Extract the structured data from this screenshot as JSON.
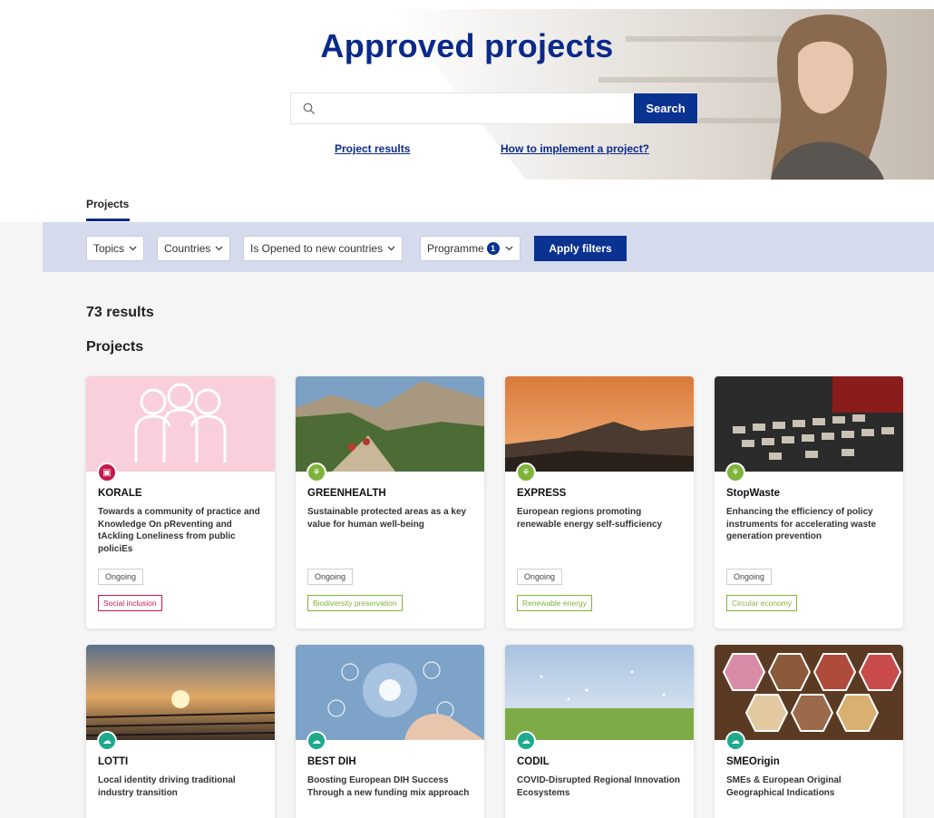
{
  "hero": {
    "title": "Approved projects",
    "search_placeholder": "",
    "search_button": "Search",
    "links": [
      "Project results",
      "How to implement a project?"
    ]
  },
  "tabs": {
    "active": "Projects"
  },
  "filters": {
    "topics": "Topics",
    "countries": "Countries",
    "opened": "Is Opened to new countries",
    "programme": "Programme",
    "programme_count": "1",
    "apply": "Apply filters"
  },
  "results": {
    "count": "73 results",
    "section": "Projects"
  },
  "colors": {
    "primary": "#0a2a8a",
    "button": "#0a3290",
    "filter_bar": "#d5daec",
    "social": "#c8174d",
    "environment": "#7fb33b",
    "innovation": "#1eaa8c"
  },
  "cards": [
    {
      "acronym": "KORALE",
      "desc": "Towards a community of practice and Knowledge On pReventing and tAckling Loneliness from public policiEs",
      "status": "Ongoing",
      "topic": "Social inclusion",
      "icon": "people-hex-icon"
    },
    {
      "acronym": "GREENHEALTH",
      "desc": "Sustainable protected areas as a key value for human well-being",
      "status": "Ongoing",
      "topic": "Biodiversity preservation",
      "icon": "windmill-icon"
    },
    {
      "acronym": "EXPRESS",
      "desc": "European regions promoting renewable energy self-sufficiency",
      "status": "Ongoing",
      "topic": "Renewable energy",
      "icon": "windmill-icon"
    },
    {
      "acronym": "StopWaste",
      "desc": "Enhancing the efficiency of policy instruments for accelerating waste generation prevention",
      "status": "Ongoing",
      "topic": "Circular economy",
      "icon": "windmill-icon"
    },
    {
      "acronym": "LOTTI",
      "desc": "Local identity driving traditional industry transition",
      "icon": "cloud-icon"
    },
    {
      "acronym": "BEST DIH",
      "desc": "Boosting European DIH Success Through a new funding mix approach",
      "icon": "cloud-icon"
    },
    {
      "acronym": "CODIL",
      "desc": "COVID-Disrupted Regional Innovation Ecosystems",
      "icon": "cloud-icon"
    },
    {
      "acronym": "SMEOrigin",
      "desc": "SMEs & European Original Geographical Indications",
      "icon": "cloud-icon"
    }
  ]
}
